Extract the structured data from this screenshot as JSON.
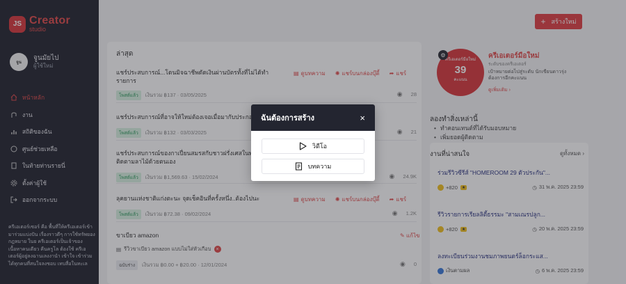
{
  "sidebar": {
    "logo_badge": "JS",
    "logo_line1": "Creator",
    "logo_line2": "studio",
    "profile_name": "จูนมัยไป",
    "profile_sub": "ผู้ใช้ใหม่",
    "items": [
      {
        "label": "หน้าหลัก",
        "icon": "home-icon"
      },
      {
        "label": "งาน",
        "icon": "task-icon"
      },
      {
        "label": "สถิติของฉัน",
        "icon": "stats-icon"
      },
      {
        "label": "ศูนย์ช่วยเหลือ",
        "icon": "help-icon"
      },
      {
        "label": "ในท้ายท่านรายนี่",
        "icon": "document-icon"
      },
      {
        "label": "ตั้งค่าผู้ใช้",
        "icon": "gear-icon"
      },
      {
        "label": "ออกจากระบบ",
        "icon": "logout-icon"
      }
    ],
    "note": "ครีเอเตอร์เซอร์ คือ พื้นที่ให้ครีเอเตอร์เข้ามาร่วมแบ่งปัน เรื่องราวดีๆ การใช้ทรัพยองกฎหมาย ในย ครีเอเตอร์เป็นเจ้าของเนื้อหาคนเดียว คืนครูโล ต้องใช้ ครีเอเตอร์ผู้อยู่ลงฉานเลงงานำ เข้าใจ เข้าร่วมได้ทุกคนที่สนใจลงชอบ เทบสื่อในทะเล"
  },
  "header": {
    "create_label": "สร้างใหม่"
  },
  "recent": {
    "title": "ล่าสุด",
    "share_actions": {
      "review": "ดูบทความ",
      "share_box": "แชร์บนกล่องบุ๊ดี้",
      "share": "แชร์"
    },
    "rows": [
      {
        "title": "แชร์ประสบการณ์...โดนมิจฉาชีพดัดเงินผ่านบัตรทั้งที่ไม่ได้ทำรายการ",
        "status": "โพสต์แล้ว",
        "meta": "เงินรวม ฿137 · 03/05/2025",
        "views": "28"
      },
      {
        "title": "แชร์ประสบการณ์ที่อาจให้ใหม่ต้องเจอเมื่อมากับประกอบ",
        "status": "โพสต์แล้ว",
        "meta": "เงินรวม ฿132 · 03/03/2025",
        "views": "21"
      },
      {
        "title": "แชร์ประสบการณ์ของกาเปี่ยนสมรสกับชาวฝรั่งเศสในพร้อมคำวิธีติดตามลาไม้ด้วยตนเอง",
        "status": "โพสต์แล้ว",
        "meta": "เงินรวม ฿1,569.63 · 15/02/2024",
        "views": "24.9K"
      },
      {
        "title": "ลุคยานแห่งชาติแก่งตะนะ จุดเช็คอินที่ครั้งหนึ่ง..ต้องไปนะ",
        "status": "โพสต์แล้ว",
        "meta": "เงินรวม ฿72.38 · 09/02/2024",
        "views": "1.2K"
      },
      {
        "title": "ขาเบียว amazon",
        "status": "ฉบับร่าง",
        "meta": "เงินรวม ฿0.00 + ฿20.00 · 12/01/2024",
        "views": "0",
        "subtitle": "รีวิวขาเบียว amazon แบบไม่ใส่หัวเกือบ",
        "edit": "แก้ไข"
      }
    ]
  },
  "level": {
    "ring_top": "ครีเอเตอร์มือใหม่",
    "ring_num": "39",
    "ring_bottom": "คะแนน",
    "title": "ครีเอเตอร์มือใหม่",
    "sub": "ระดับของครีเอเตอร์",
    "desc": "เป้าหมายต่อไปสู่ระดับ นักเขียนดาวรุ่งต้องการอีกคะแนน",
    "link": "ดูเพิ่มเติม ›",
    "try_title": "ลองทำสิ่งเหล่านี้",
    "try_items": [
      "ทำคอนเทนต์ที่ได้รับมอบหมาย",
      "เพิ่มยอดผู้ติดตาม"
    ]
  },
  "events": {
    "title": "งานที่น่าสนใจ",
    "all": "ดูทั้งหมด ›",
    "items": [
      {
        "title": "ร่วมรีวิวซีรีส์ \"HOMEROOM 29 ตัวประกัน\"...",
        "reward": "+820",
        "deadline": "31 พ.ค. 2025 23:59"
      },
      {
        "title": "รีวิวรายการเรียลลิตี้ธรรมะ \"สามเณรปลูก...",
        "reward": "+820",
        "deadline": "20 พ.ค. 2025 23:59"
      },
      {
        "title": "ลงทะเบียนร่วมงานชมภาพยนตร์ล็อกระแส...",
        "reward": "เงินตามผล",
        "deadline": "6 พ.ค. 2025 23:59"
      }
    ]
  },
  "modal": {
    "title": "ฉันต้องการสร้าง",
    "close": "×",
    "options": [
      {
        "label": "วิดีโอ",
        "icon": "play-icon"
      },
      {
        "label": "บทความ",
        "icon": "article-icon"
      }
    ]
  },
  "colors": {
    "accent": "#e04045",
    "sidebar": "#232530",
    "modal_header": "#232530"
  }
}
